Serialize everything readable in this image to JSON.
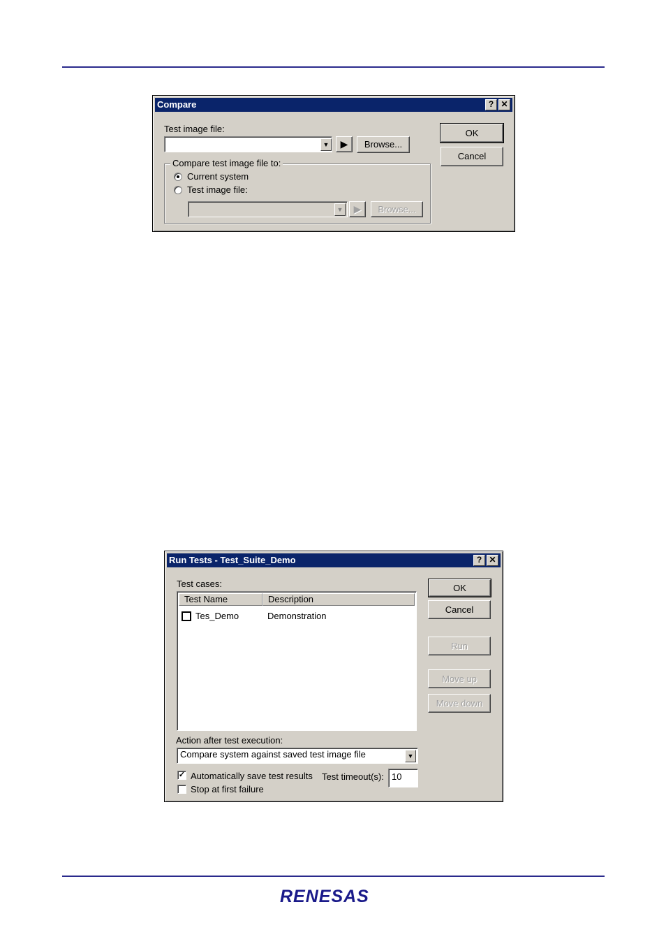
{
  "compare": {
    "title": "Compare",
    "help_glyph": "?",
    "close_glyph": "✕",
    "test_image_label": "Test image file:",
    "test_image_value": "",
    "browse1": "Browse...",
    "ok": "OK",
    "cancel": "Cancel",
    "group_label": "Compare test image file to:",
    "radio_current": "Current system",
    "radio_test": "Test image file:",
    "test_image2_value": "",
    "browse2": "Browse...",
    "selected_option": "Current system"
  },
  "run_tests": {
    "title": "Run Tests - Test_Suite_Demo",
    "help_glyph": "?",
    "close_glyph": "✕",
    "test_cases_label": "Test cases:",
    "columns": [
      "Test Name",
      "Description"
    ],
    "rows": [
      {
        "name": "Tes_Demo",
        "description": "Demonstration",
        "checked": false
      }
    ],
    "ok": "OK",
    "cancel": "Cancel",
    "run": "Run",
    "move_up": "Move up",
    "move_down": "Move down",
    "action_label": "Action after test execution:",
    "action_value": "Compare system against saved test image file",
    "auto_save_label": "Automatically save test results",
    "auto_save_checked": true,
    "timeout_label": "Test timeout(s):",
    "timeout_value": "10",
    "stop_label": "Stop at first failure",
    "stop_checked": false
  },
  "footer": {
    "logo_text": "RENESAS"
  },
  "colors": {
    "rule": "#2a2a8c",
    "titlebar": "#0a246a",
    "dialog_face": "#d4d0c8"
  }
}
